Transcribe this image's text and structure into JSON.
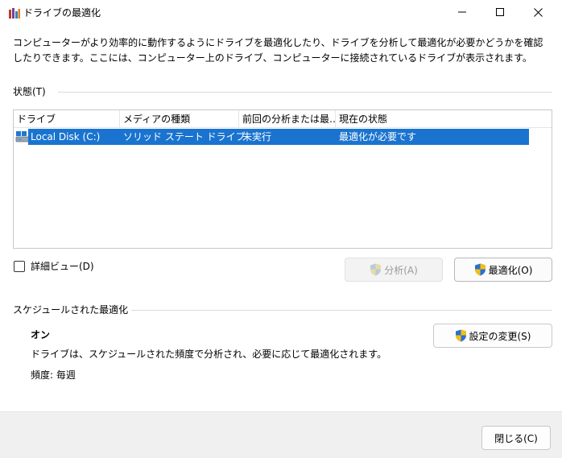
{
  "window": {
    "title": "ドライブの最適化",
    "controls": {
      "minimize": "—",
      "maximize": "☐",
      "close": "✕"
    }
  },
  "description": "コンピューターがより効率的に動作するようにドライブを最適化したり、ドライブを分析して最適化が必要かどうかを確認したりできます。ここには、コンピューター上のドライブ、コンピューターに接続されているドライブが表示されます。",
  "status_group": {
    "label": "状態(T)",
    "columns": [
      "ドライブ",
      "メディアの種類",
      "前回の分析または最…",
      "現在の状態"
    ],
    "rows": [
      {
        "drive": "Local Disk (C:)",
        "media_type": "ソリッド ステート ドライブ",
        "last_run": "未実行",
        "current_status": "最適化が必要です"
      }
    ]
  },
  "detail_view_label": "詳細ビュー(D)",
  "buttons": {
    "analyze": "分析(A)",
    "optimize": "最適化(O)",
    "change_settings": "設定の変更(S)",
    "close": "閉じる(C)"
  },
  "schedule_group": {
    "label": "スケジュールされた最適化",
    "state": "オン",
    "description": "ドライブは、スケジュールされた頻度で分析され、必要に応じて最適化されます。",
    "frequency": "頻度: 毎週"
  },
  "colors": {
    "selection": "#1a74cf",
    "shield_blue": "#2a6fd6",
    "shield_yellow": "#f2c10f"
  }
}
